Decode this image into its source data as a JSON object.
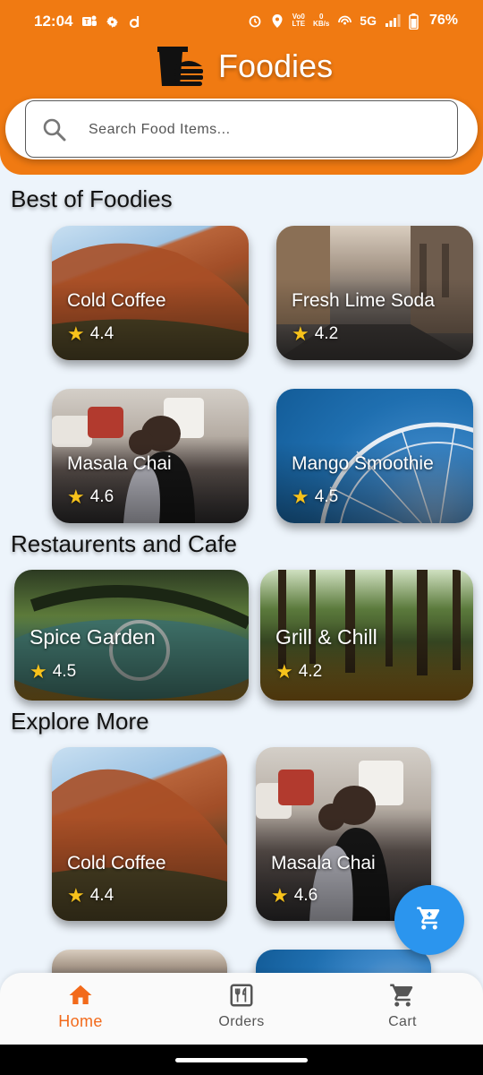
{
  "status_bar": {
    "time": "12:04",
    "left_icons": [
      "teams-icon",
      "settings-gear-icon",
      "d-app-icon"
    ],
    "right_icons": [
      "alarm-icon",
      "location-icon",
      "volte-icon",
      "data-speed-icon",
      "hotspot-icon",
      "signal-icon",
      "battery-icon"
    ],
    "volte_top": "Vo0",
    "volte_bottom": "LTE",
    "speed_top": "0",
    "speed_bottom": "KB/s",
    "network": "5G",
    "battery": "76%"
  },
  "header": {
    "app_name": "Foodies",
    "logo_icon": "burger-box-icon",
    "accent_color": "#f07a12"
  },
  "search": {
    "placeholder": "Search Food Items...",
    "value": ""
  },
  "sections": {
    "best": {
      "title": "Best of Foodies",
      "items": [
        {
          "name": "Cold Coffee",
          "rating": "4.4"
        },
        {
          "name": "Fresh Lime Soda",
          "rating": "4.2"
        },
        {
          "name": "Masala Chai",
          "rating": "4.6"
        },
        {
          "name": "Mango Smoothie",
          "rating": "4.5"
        }
      ]
    },
    "restaurants": {
      "title": "Restaurents and Cafe",
      "items": [
        {
          "name": "Spice Garden",
          "rating": "4.5"
        },
        {
          "name": "Grill & Chill",
          "rating": "4.2"
        }
      ]
    },
    "explore": {
      "title": "Explore More",
      "items": [
        {
          "name": "Cold Coffee",
          "rating": "4.4"
        },
        {
          "name": "Masala Chai",
          "rating": "4.6"
        }
      ]
    }
  },
  "fab": {
    "icon": "cart-icon",
    "color": "#2b95ee"
  },
  "bottom_nav": {
    "items": [
      {
        "label": "Home",
        "icon": "home-icon",
        "active": true
      },
      {
        "label": "Orders",
        "icon": "orders-icon",
        "active": false
      },
      {
        "label": "Cart",
        "icon": "cart-icon",
        "active": false
      }
    ]
  }
}
